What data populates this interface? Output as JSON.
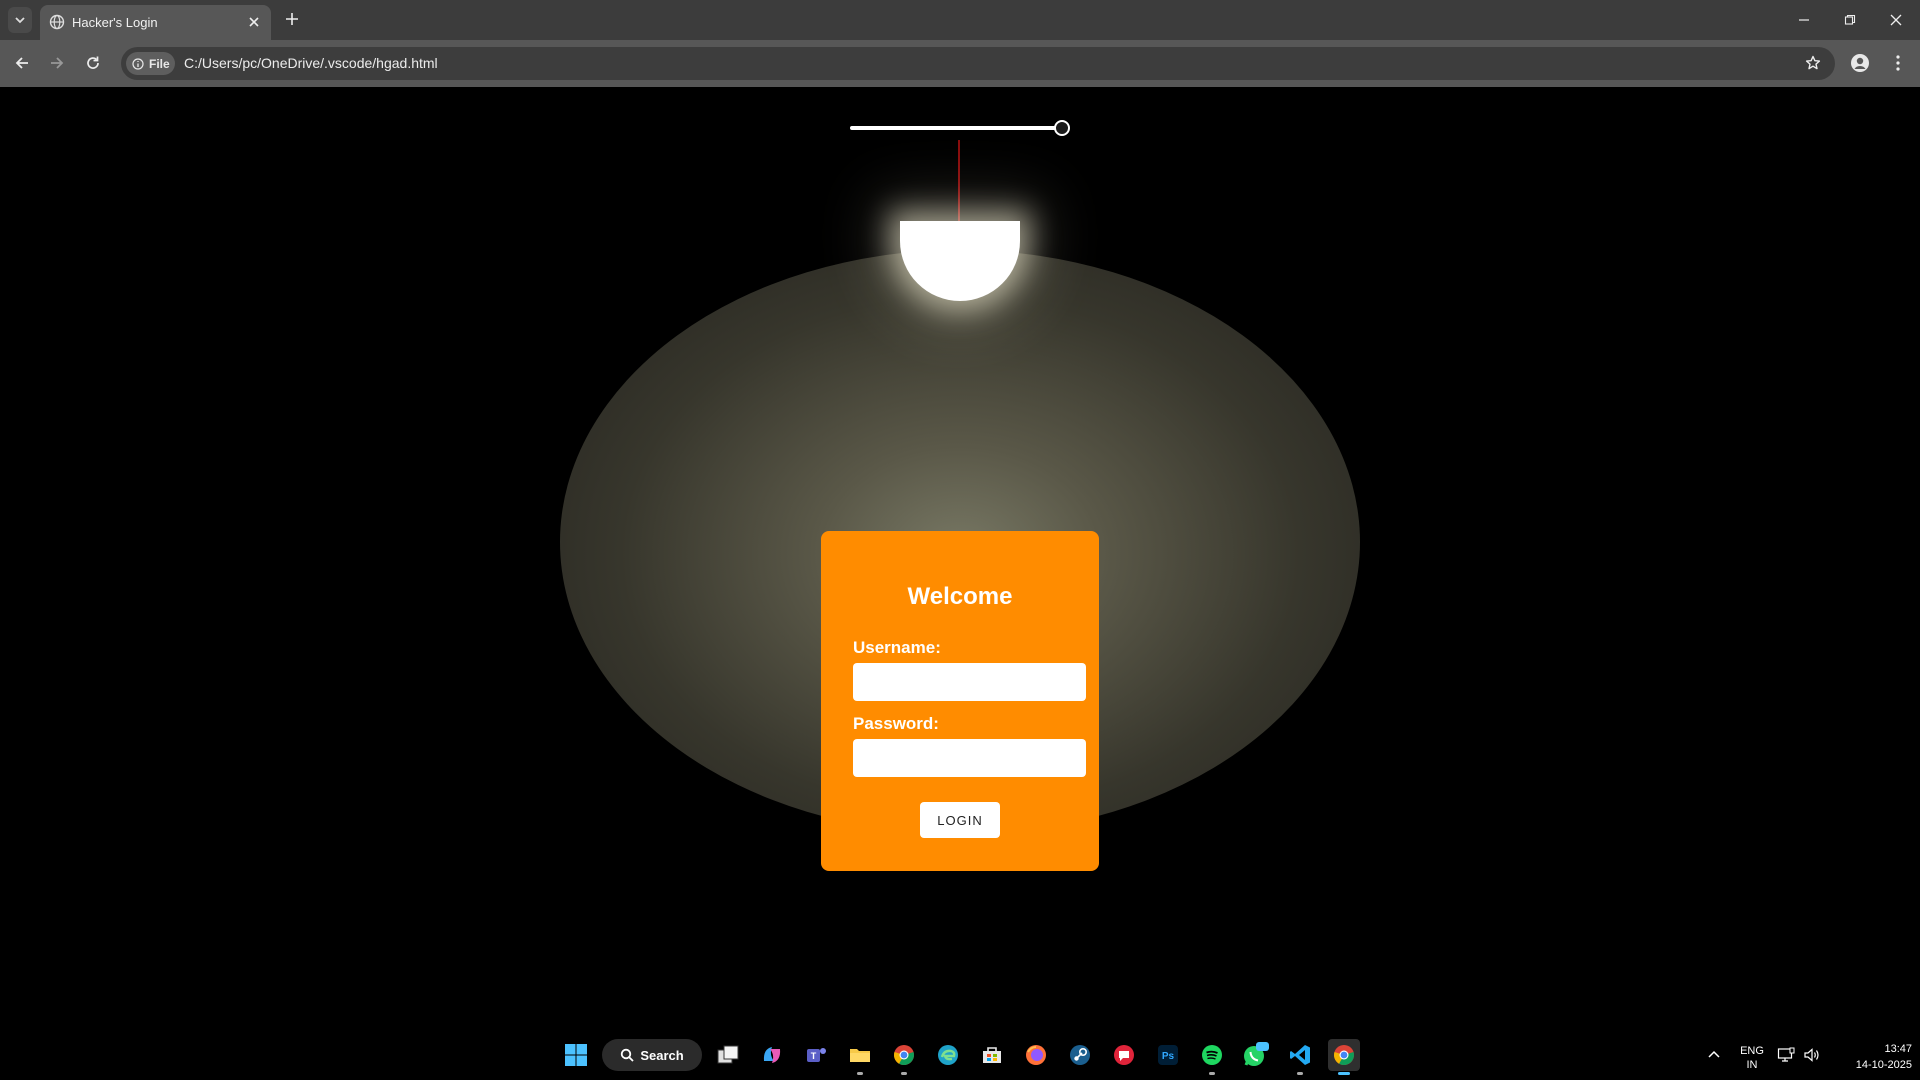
{
  "browser": {
    "tab_title": "Hacker's Login",
    "site_chip_label": "File",
    "url": "C:/Users/pc/OneDrive/.vscode/hgad.html"
  },
  "page": {
    "slider_level": 1.0,
    "card": {
      "heading": "Welcome",
      "username_label": "Username:",
      "username_value": "",
      "password_label": "Password:",
      "password_value": "",
      "login_label": "LOGIN"
    },
    "colors": {
      "card": "#ff8c00",
      "cord": "#8a0d0d",
      "background": "#000000"
    }
  },
  "taskbar": {
    "search_label": "Search",
    "apps": [
      "start-icon",
      "task-view-icon",
      "copilot-icon",
      "teams-icon",
      "file-explorer-icon",
      "chrome-icon",
      "edge-icon",
      "store-icon",
      "firefox-icon",
      "steam-icon",
      "app-icon",
      "photoshop-icon",
      "spotify-icon",
      "whatsapp-icon",
      "vscode-icon",
      "chrome-active-icon"
    ],
    "language_line1": "ENG",
    "language_line2": "IN",
    "time": "13:47",
    "date": "14-10-2025"
  }
}
